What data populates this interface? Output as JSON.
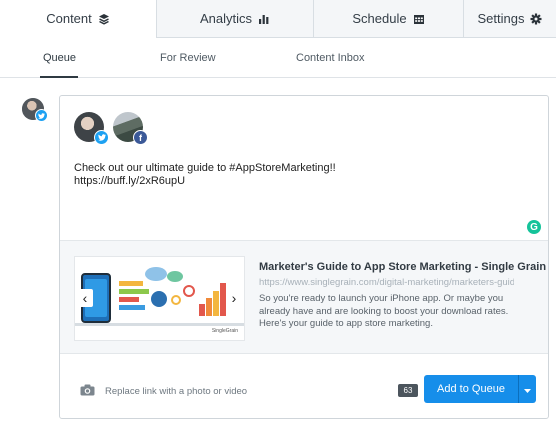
{
  "top_tabs": [
    {
      "label": "Content",
      "icon": "layers-icon",
      "active": true
    },
    {
      "label": "Analytics",
      "icon": "bar-chart-icon",
      "active": false
    },
    {
      "label": "Schedule",
      "icon": "calendar-icon",
      "active": false
    },
    {
      "label": "Settings",
      "icon": "gear-icon",
      "active": false
    }
  ],
  "sub_tabs": [
    {
      "label": "Queue",
      "active": true
    },
    {
      "label": "For Review",
      "active": false
    },
    {
      "label": "Content Inbox",
      "active": false
    }
  ],
  "composer": {
    "selected_profiles": [
      {
        "network": "twitter",
        "badge_icon": "twitter-icon"
      },
      {
        "network": "facebook",
        "badge_icon": "facebook-icon",
        "badge_text": "f"
      }
    ],
    "text": "Check out our ultimate guide to #AppStoreMarketing!!\nhttps://buff.ly/2xR6upU",
    "grammarly_label": "G",
    "link_preview": {
      "title": "Marketer's Guide to App Store Marketing - Single Grain",
      "url": "https://www.singlegrain.com/digital-marketing/marketers-guide-app-",
      "description": "So you're ready to launch your iPhone app. Or maybe you already have and are looking to boost your download rates. Here's your guide to app store marketing.",
      "thumbnail_brand": "SingleGrain",
      "prev_arrow": "‹",
      "next_arrow": "›"
    },
    "media_label": "Replace link with a photo or video",
    "char_count": "63",
    "add_button_label": "Add to Queue"
  },
  "colors": {
    "accent": "#168eea",
    "twitter": "#1da1f2",
    "facebook": "#3b5998",
    "grammarly": "#15c39a"
  }
}
